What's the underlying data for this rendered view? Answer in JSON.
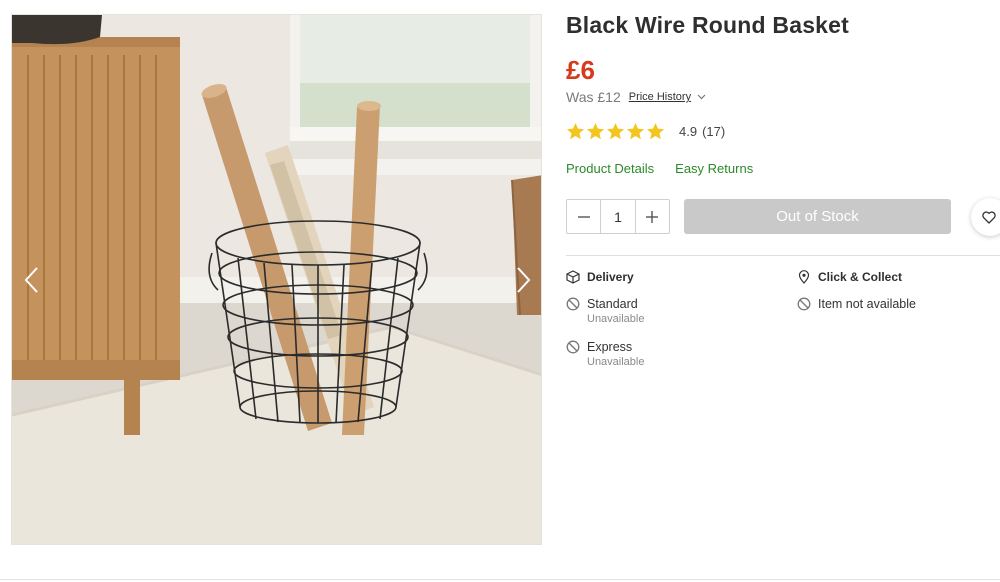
{
  "gallery": {
    "prev_icon": "chevron-left-icon",
    "next_icon": "chevron-right-icon"
  },
  "product": {
    "title": "Black Wire Round Basket",
    "price": "£6",
    "was_price": "Was £12",
    "price_history_label": "Price History",
    "rating_value": "4.9",
    "rating_count": "(17)",
    "stars_filled": 5,
    "stars_total": 5,
    "star_color": "#f2c51f",
    "price_color": "#d73a1b",
    "link_color": "#2a8a2a",
    "links": {
      "details": "Product Details",
      "returns": "Easy Returns"
    }
  },
  "purchase": {
    "quantity": "1",
    "cta_label": "Out of Stock",
    "wishlist_icon": "heart-icon"
  },
  "delivery": {
    "heading": "Delivery",
    "options": [
      {
        "name": "Standard",
        "status": "Unavailable"
      },
      {
        "name": "Express",
        "status": "Unavailable"
      }
    ]
  },
  "collect": {
    "heading": "Click & Collect",
    "status": "Item not available"
  }
}
